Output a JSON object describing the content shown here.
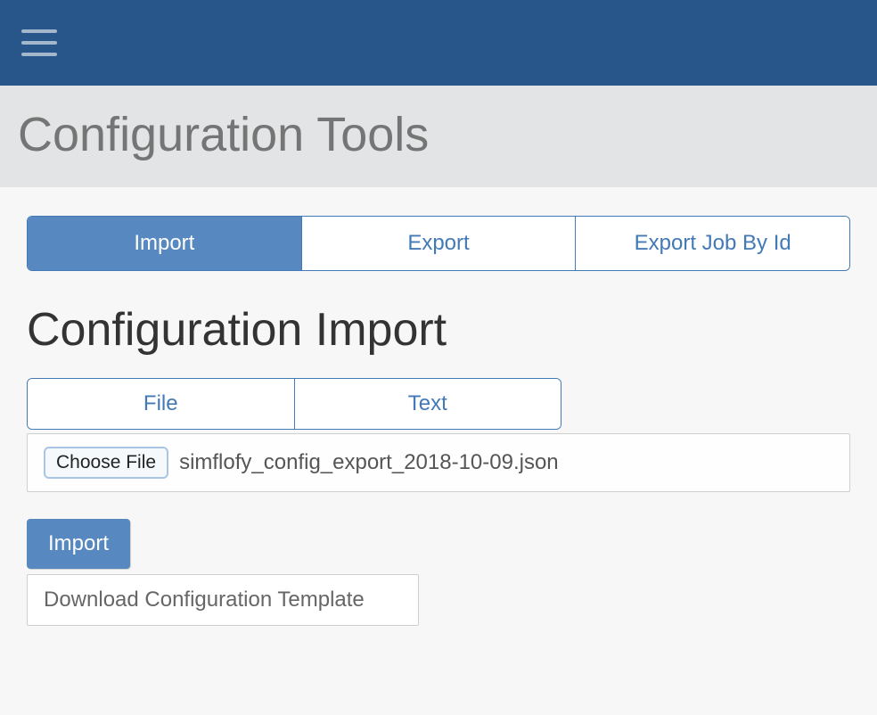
{
  "header": {
    "page_title": "Configuration Tools"
  },
  "tabs": {
    "items": [
      {
        "label": "Import",
        "active": true
      },
      {
        "label": "Export",
        "active": false
      },
      {
        "label": "Export Job By Id",
        "active": false
      }
    ]
  },
  "section": {
    "heading": "Configuration Import"
  },
  "sub_tabs": {
    "items": [
      {
        "label": "File"
      },
      {
        "label": "Text"
      }
    ]
  },
  "file_picker": {
    "button_label": "Choose File",
    "selected_file": "simflofy_config_export_2018-10-09.json"
  },
  "actions": {
    "import_label": "Import",
    "download_template_label": "Download Configuration Template"
  }
}
